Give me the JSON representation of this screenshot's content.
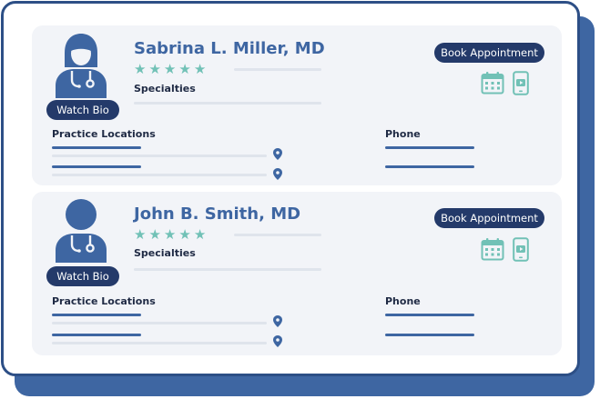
{
  "doctors": [
    {
      "name": "Sabrina L. Miller, MD",
      "rating": 5,
      "specialties_label": "Specialties",
      "watch_bio_label": "Watch Bio",
      "book_label": "Book Appointment",
      "practice_locations_label": "Practice Locations",
      "phone_label": "Phone",
      "avatar": "female-doctor-icon"
    },
    {
      "name": "John B. Smith, MD",
      "rating": 5,
      "specialties_label": "Specialties",
      "watch_bio_label": "Watch Bio",
      "book_label": "Book Appointment",
      "practice_locations_label": "Practice Locations",
      "phone_label": "Phone",
      "avatar": "male-doctor-icon"
    }
  ],
  "icons": [
    "calendar-icon",
    "video-phone-icon",
    "map-pin-icon",
    "star-icon"
  ],
  "colors": {
    "brand_blue": "#3e66a2",
    "navy": "#243a6a",
    "teal": "#71c1b6",
    "card_bg": "#f2f4f8",
    "placeholder_line": "#dfe4ec"
  }
}
